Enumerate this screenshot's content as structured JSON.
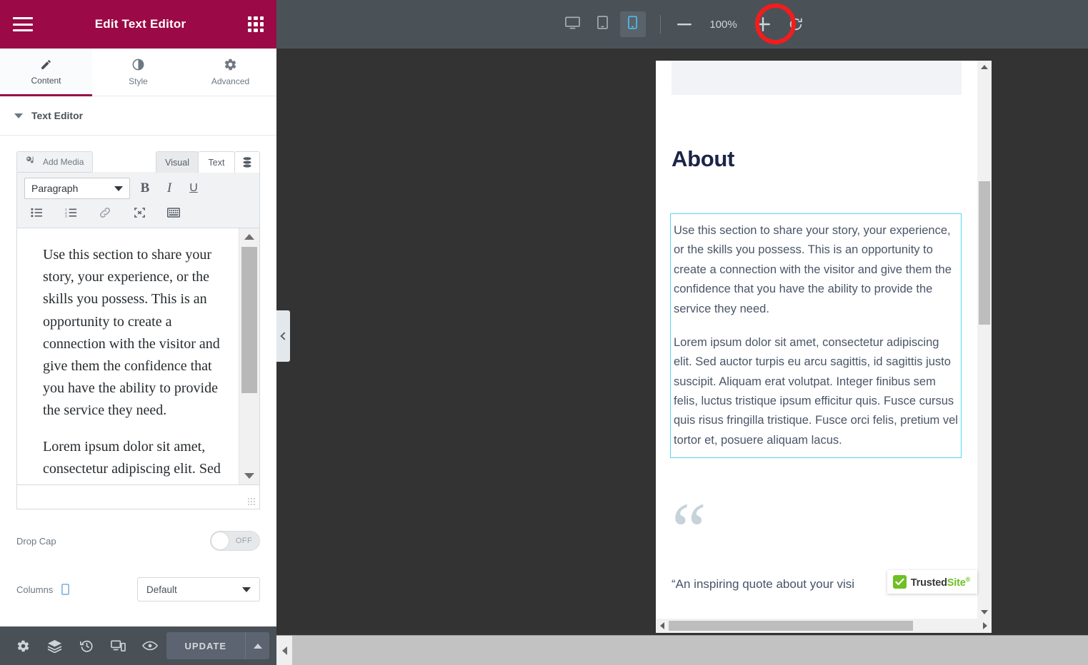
{
  "panel": {
    "title": "Edit Text Editor",
    "menu_icon": "hamburger-icon",
    "widgets_icon": "grid-icon",
    "tabs": [
      {
        "label": "Content",
        "icon": "pencil-icon",
        "active": true
      },
      {
        "label": "Style",
        "icon": "contrast-icon",
        "active": false
      },
      {
        "label": "Advanced",
        "icon": "gear-icon",
        "active": false
      }
    ],
    "section_title": "Text Editor",
    "editor": {
      "add_media_label": "Add Media",
      "mode_tabs": [
        {
          "label": "Visual",
          "active": false
        },
        {
          "label": "Text",
          "active": true
        }
      ],
      "db_tab_icon": "database-icon",
      "format_select_value": "Paragraph",
      "format_buttons": [
        {
          "label": "B",
          "name": "bold-button"
        },
        {
          "label": "I",
          "name": "italic-button"
        },
        {
          "label": "U",
          "name": "underline-button"
        }
      ],
      "row2_icons": [
        "bulleted-list-icon",
        "numbered-list-icon",
        "link-icon",
        "fullscreen-icon",
        "keyboard-shortcuts-icon"
      ],
      "content_paragraph_1": "Use this section to share your story, your experience, or the skills you possess. This is an opportunity to create a connection with the visitor and give them the confidence that you have the ability to provide the service they need.",
      "content_paragraph_2": "Lorem ipsum dolor sit amet, consectetur adipiscing elit. Sed auctor turpis eu arcu sagittis, id sagittis justo suscipit. Aliquam erat volutpat."
    },
    "controls": {
      "drop_cap_label": "Drop Cap",
      "drop_cap_state": "OFF",
      "columns_label": "Columns",
      "columns_responsive_icon": "mobile-icon",
      "columns_value": "Default"
    },
    "footer": {
      "icons": [
        "settings-gear-icon",
        "navigator-layers-icon",
        "history-icon",
        "responsive-mode-icon",
        "preview-eye-icon"
      ],
      "update_label": "UPDATE",
      "update_caret_icon": "chevron-up-icon"
    },
    "collapse_icon": "chevron-left-icon"
  },
  "topbar": {
    "devices": [
      {
        "name": "desktop",
        "icon": "desktop-icon",
        "active": false
      },
      {
        "name": "tablet",
        "icon": "tablet-icon",
        "active": false
      },
      {
        "name": "mobile",
        "icon": "mobile-icon",
        "active": true
      }
    ],
    "zoom_out_icon": "minus-icon",
    "zoom_value": "100%",
    "zoom_in_icon": "plus-icon",
    "reset_icon": "reset-icon",
    "annotation": {
      "type": "red-circle-highlight",
      "target": "mobile-device-button",
      "color": "#f41c1c"
    }
  },
  "preview": {
    "heading": "About",
    "paragraph_1": "Use this section to share your story, your experience, or the skills you possess. This is an opportunity to create a connection with the visitor and give them the confidence that you have the ability to provide the service they need.",
    "paragraph_2": "Lorem ipsum dolor sit amet, consectetur adipiscing elit. Sed auctor turpis eu arcu sagittis, id sagittis justo suscipit. Aliquam erat volutpat. Integer finibus sem felis, luctus tristique ipsum efficitur quis. Fusce cursus quis risus fringilla tristique. Fusce orci felis, pretium vel tortor et, posuere aliquam lacus.",
    "quote_mark": "“",
    "quote_text": "“An inspiring quote about your visi",
    "selection_color": "#55d7f0",
    "trusted_site": {
      "brand_bold": "Trusted",
      "brand_green": "Site",
      "trademark": "®",
      "check_icon": "checkmark-icon",
      "green": "#6ec023"
    }
  },
  "colors": {
    "brand_maroon": "#9b0a46",
    "topbar_gray": "#4a5258",
    "canvas_gray": "#333333",
    "footer_gray": "#495157",
    "heading_navy": "#1b2448"
  }
}
